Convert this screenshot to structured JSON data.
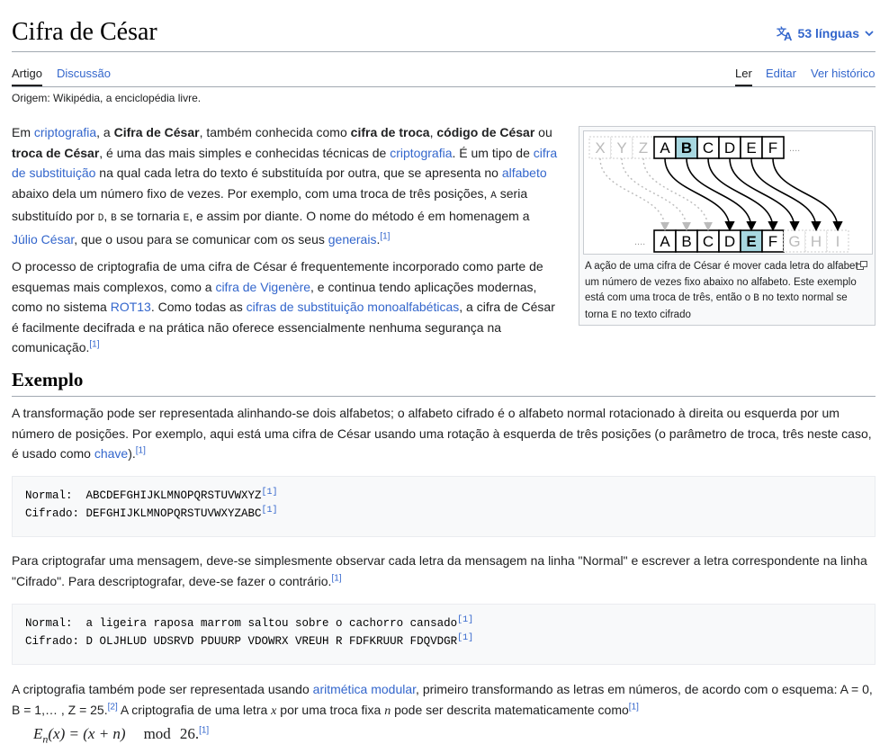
{
  "header": {
    "title": "Cifra de César",
    "languages_label": "53 línguas"
  },
  "tabs": {
    "article": "Artigo",
    "discussion": "Discussão",
    "read": "Ler",
    "edit": "Editar",
    "history": "Ver histórico"
  },
  "origin": "Origem: Wikipédia, a enciclopédia livre.",
  "intro": {
    "p1": {
      "t1": "Em ",
      "l1": "criptografia",
      "t2": ", a ",
      "b1": "Cifra de César",
      "t3": ", também conhecida como ",
      "b2": "cifra de troca",
      "t4": ", ",
      "b3": "código de César",
      "t5": " ou ",
      "b4": "troca de César",
      "t6": ", é uma das mais simples e conhecidas técnicas de ",
      "l2": "criptografia",
      "t7": ". É um tipo de ",
      "l3": "cifra de substituição",
      "t8": " na qual cada letra do texto é substituída por outra, que se apresenta no ",
      "l4": "alfabeto",
      "t9": " abaixo dela um número fixo de vezes. Por exemplo, com uma troca de três posições, ",
      "c1": "A",
      "t10": " seria substituído por ",
      "c2": "D",
      "t11": ", ",
      "c3": "B",
      "t12": " se tornaria ",
      "c4": "E",
      "t13": ", e assim por diante. O nome do método é em homenagem a ",
      "l5": "Júlio César",
      "t14": ", que o usou para se comunicar com os seus ",
      "l6": "generais",
      "t15": ".",
      "ref": "[1]"
    },
    "p2": {
      "t1": "O processo de criptografia de uma cifra de César é frequentemente incorporado como parte de esquemas mais complexos, como a ",
      "l1": "cifra de Vigenère",
      "t2": ", e continua tendo aplicações modernas, como no sistema ",
      "l2": "ROT13",
      "t3": ". Como todas as ",
      "l3": "cifras de substituição monoalfabéticas",
      "t4": ", a cifra de César é facilmente decifrada e na prática não oferece essencialmente nenhuma segurança na comunicação.",
      "ref": "[1]"
    }
  },
  "figure": {
    "top_letters": [
      "X",
      "Y",
      "Z",
      "A",
      "B",
      "C",
      "D",
      "E",
      "F"
    ],
    "bottom_letters": [
      "A",
      "B",
      "C",
      "D",
      "E",
      "F",
      "G",
      "H",
      "I"
    ],
    "ellipsis": "....",
    "caption": {
      "t1": "A ação de uma cifra de César é mover cada letra do alfabeto um número de vezes fixo abaixo no alfabeto. Este exemplo está com uma troca de três, então o ",
      "c1": "B",
      "t2": " no texto normal se torna ",
      "c2": "E",
      "t3": " no texto cifrado"
    },
    "colors": {
      "highlight": "#a7d7e0",
      "link": "#3366cc"
    }
  },
  "section": {
    "heading": "Exemplo",
    "p1": {
      "t1": "A transformação pode ser representada alinhando-se dois alfabetos; o alfabeto cifrado é o alfabeto normal rotacionado à direita ou esquerda por um número de posições. Por exemplo, aqui está uma cifra de César usando uma rotação à esquerda de três posições (o parâmetro de troca, três neste caso, é usado como ",
      "l1": "chave",
      "t2": ").",
      "ref": "[1]"
    },
    "pre1": {
      "line1": "Normal:  ABCDEFGHIJKLMNOPQRSTUVWXYZ",
      "ref1": "[1]",
      "line2": "Cifrado: DEFGHIJKLMNOPQRSTUVWXYZABC",
      "ref2": "[1]"
    },
    "p2": {
      "t1": "Para criptografar uma mensagem, deve-se simplesmente observar cada letra da mensagem na linha \"Normal\" e escrever a letra correspondente na linha \"Cifrado\". Para descriptografar, deve-se fazer o contrário.",
      "ref": "[1]"
    },
    "pre2": {
      "line1": "Normal:  a ligeira raposa marrom saltou sobre o cachorro cansado",
      "ref1": "[1]",
      "line2": "Cifrado: D OLJHLUD UDSRVD PDUURP VDOWRX VREUH R FDFKRUUR FDQVDGR",
      "ref2": "[1]"
    },
    "p3": {
      "t1": "A criptografia também pode ser representada usando ",
      "l1": "aritmética modular",
      "t2": ", primeiro transformando as letras em números, de acordo com o esquema: A = 0, B = 1,… , Z = 25.",
      "ref1": "[2]",
      "t3": " A criptografia de uma letra ",
      "v1": "x",
      "t4": " por uma troca fixa ",
      "v2": "n",
      "t5": " pode ser descrita matematicamente como",
      "ref2": "[1]"
    },
    "formula": {
      "lhs": "E",
      "sub": "n",
      "arg": "(x)",
      "eq": " = (x + n)",
      "mod": "mod",
      "num": "26.",
      "ref": "[1]"
    }
  }
}
